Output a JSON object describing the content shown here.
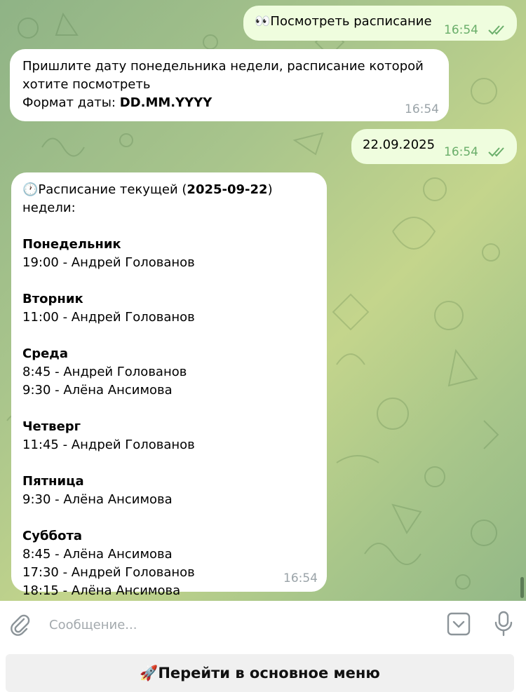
{
  "messages": [
    {
      "id": "m1",
      "direction": "out",
      "emoji": "👀",
      "text": "Посмотреть расписание",
      "time": "16:54",
      "read": true
    },
    {
      "id": "m2",
      "direction": "in",
      "lines": [
        "Пришлите дату понедельника недели, расписание которой",
        "хотите посмотреть"
      ],
      "format_prefix": "Формат даты: ",
      "format_value": "DD.MM.YYYY",
      "time": "16:54"
    },
    {
      "id": "m3",
      "direction": "out",
      "text": "22.09.2025",
      "time": "16:54",
      "read": true
    },
    {
      "id": "m4",
      "direction": "in",
      "emoji": "🕐",
      "title_pre": "Расписание текущей (",
      "title_date": "2025-09-22",
      "title_post": ") недели:",
      "days": [
        {
          "name": "Понедельник",
          "entries": [
            "19:00 - Андрей Голованов"
          ]
        },
        {
          "name": "Вторник",
          "entries": [
            "11:00 - Андрей Голованов"
          ]
        },
        {
          "name": "Среда",
          "entries": [
            "8:45 - Андрей Голованов",
            "9:30 - Алёна Ансимова"
          ]
        },
        {
          "name": "Четверг",
          "entries": [
            "11:45 - Андрей Голованов"
          ]
        },
        {
          "name": "Пятница",
          "entries": [
            "9:30 - Алёна Ансимова"
          ]
        },
        {
          "name": "Суббота",
          "entries": [
            "8:45 - Алёна Ансимова",
            "17:30 - Андрей Голованов",
            "18:15 - Алёна Ансимова"
          ]
        }
      ],
      "time": "16:54"
    }
  ],
  "composer": {
    "placeholder": "Сообщение...",
    "attach_icon": "paperclip-icon",
    "keyboard_icon": "bot-keyboard-icon",
    "mic_icon": "microphone-icon"
  },
  "reply_keyboard": {
    "emoji": "🚀",
    "label": "Перейти в основное меню"
  },
  "colors": {
    "outgoing": "#effdde",
    "incoming": "#ffffff",
    "time_out": "#6aae6a",
    "time_in": "#9aa3a8"
  }
}
